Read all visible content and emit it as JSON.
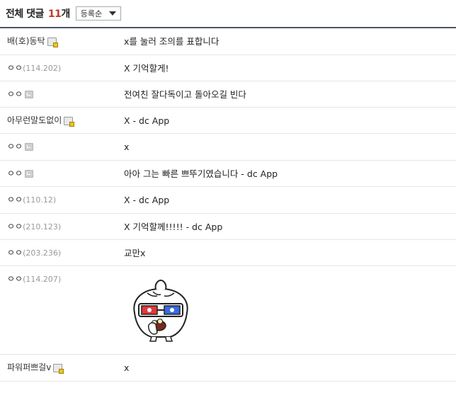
{
  "header": {
    "title": "전체 댓글",
    "count": "11",
    "count_unit": "개",
    "sort_label": "등록순"
  },
  "comments": [
    {
      "nick": "배(호)동탁",
      "ip": "",
      "icon": "fixed-nick-icon",
      "text": "x를 눌러 조의를 표합니다"
    },
    {
      "nick": "ㅇㅇ",
      "ip": "(114.202)",
      "icon": "",
      "text": "X 기억할게!"
    },
    {
      "nick": "ㅇㅇ",
      "ip": "",
      "icon": "guest-nick-icon",
      "text": "전여친 잘다독이고 돌아오길 빈다"
    },
    {
      "nick": "아무런말도없이",
      "ip": "",
      "icon": "fixed-nick-icon",
      "text": "X - dc App"
    },
    {
      "nick": "ㅇㅇ",
      "ip": "",
      "icon": "guest-nick-icon",
      "text": "x"
    },
    {
      "nick": "ㅇㅇ",
      "ip": "",
      "icon": "guest-nick-icon",
      "text": "아아 그는 빠른 쁘뚜기였습니다 - dc App"
    },
    {
      "nick": "ㅇㅇ",
      "ip": "(110.12)",
      "icon": "",
      "text": "X - dc App"
    },
    {
      "nick": "ㅇㅇ",
      "ip": "(210.123)",
      "icon": "",
      "text": "X 기억할께!!!!! - dc App"
    },
    {
      "nick": "ㅇㅇ",
      "ip": "(203.236)",
      "icon": "",
      "text": "교만x"
    },
    {
      "nick": "ㅇㅇ",
      "ip": "(114.207)",
      "icon": "",
      "text": "",
      "sticker": "dumpling-3d-glasses-sticker"
    },
    {
      "nick": "파워퍼쁘걸v",
      "ip": "",
      "icon": "fixed-nick-icon",
      "text": "x"
    }
  ],
  "colors": {
    "accent_count": "#c0392b",
    "header_rule": "#4d5366",
    "ip_gray": "#999999",
    "row_divider": "#e6e6e6"
  }
}
